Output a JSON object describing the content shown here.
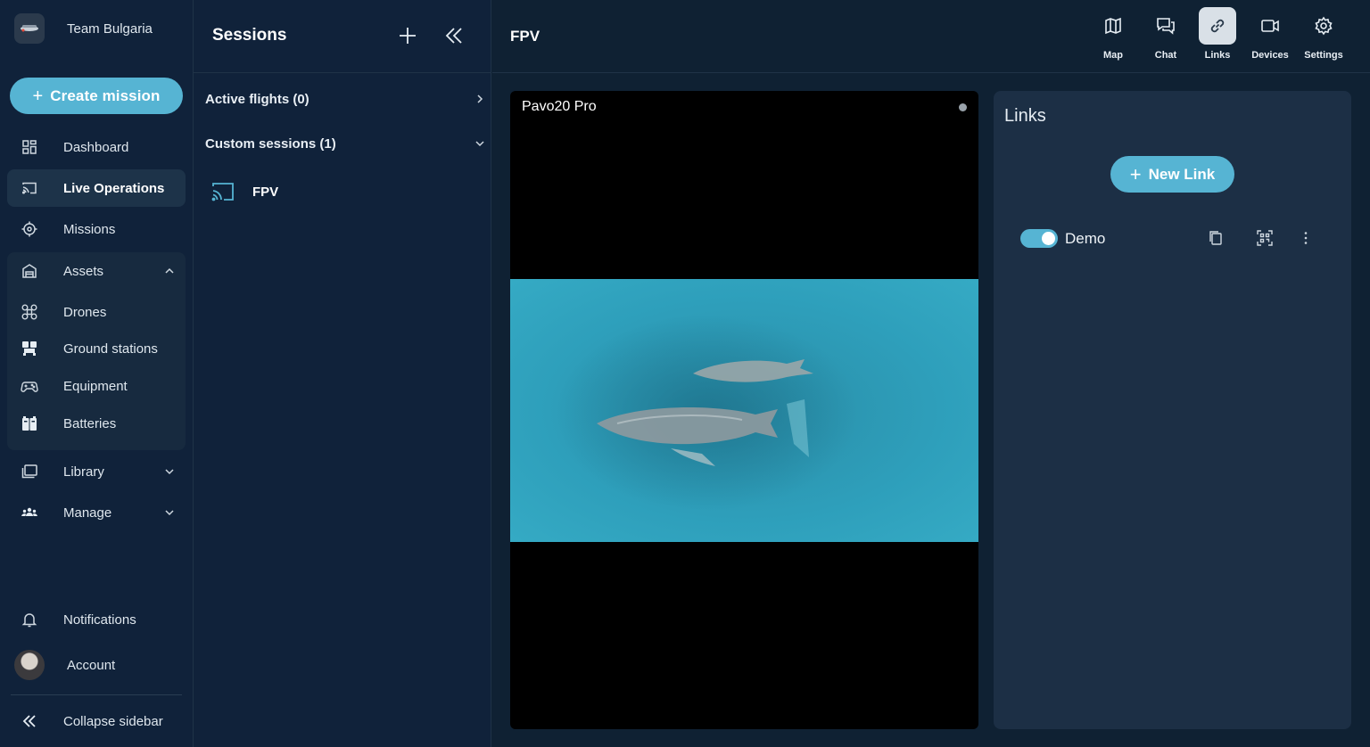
{
  "sidebar": {
    "team_name": "Team Bulgaria",
    "create_label": "Create mission",
    "items": [
      {
        "label": "Dashboard",
        "icon": "dashboard-icon"
      },
      {
        "label": "Live Operations",
        "icon": "cast-icon",
        "active": true
      },
      {
        "label": "Missions",
        "icon": "target-icon"
      },
      {
        "label": "Assets",
        "icon": "warehouse-icon",
        "expanded": true
      },
      {
        "label": "Drones",
        "icon": "drone-icon"
      },
      {
        "label": "Ground stations",
        "icon": "ground-station-icon"
      },
      {
        "label": "Equipment",
        "icon": "gamepad-icon"
      },
      {
        "label": "Batteries",
        "icon": "battery-icon"
      },
      {
        "label": "Library",
        "icon": "library-icon"
      },
      {
        "label": "Manage",
        "icon": "team-icon"
      }
    ],
    "notifications_label": "Notifications",
    "account_label": "Account",
    "collapse_label": "Collapse sidebar"
  },
  "sessions": {
    "title": "Sessions",
    "active_flights_label": "Active flights (0)",
    "custom_sessions_label": "Custom sessions (1)",
    "items": [
      {
        "label": "FPV"
      }
    ]
  },
  "main": {
    "title": "FPV",
    "toolbar": [
      {
        "label": "Map",
        "icon": "map-icon"
      },
      {
        "label": "Chat",
        "icon": "chat-icon"
      },
      {
        "label": "Links",
        "icon": "link-icon",
        "active": true
      },
      {
        "label": "Devices",
        "icon": "video-camera-icon"
      },
      {
        "label": "Settings",
        "icon": "gear-icon"
      }
    ],
    "video": {
      "device_name": "Pavo20 Pro"
    }
  },
  "links_panel": {
    "title": "Links",
    "new_link_label": "New Link",
    "links": [
      {
        "name": "Demo",
        "enabled": true
      }
    ]
  },
  "colors": {
    "accent": "#56b4d3",
    "background": "#0f2133",
    "panel": "#1c2f45"
  }
}
